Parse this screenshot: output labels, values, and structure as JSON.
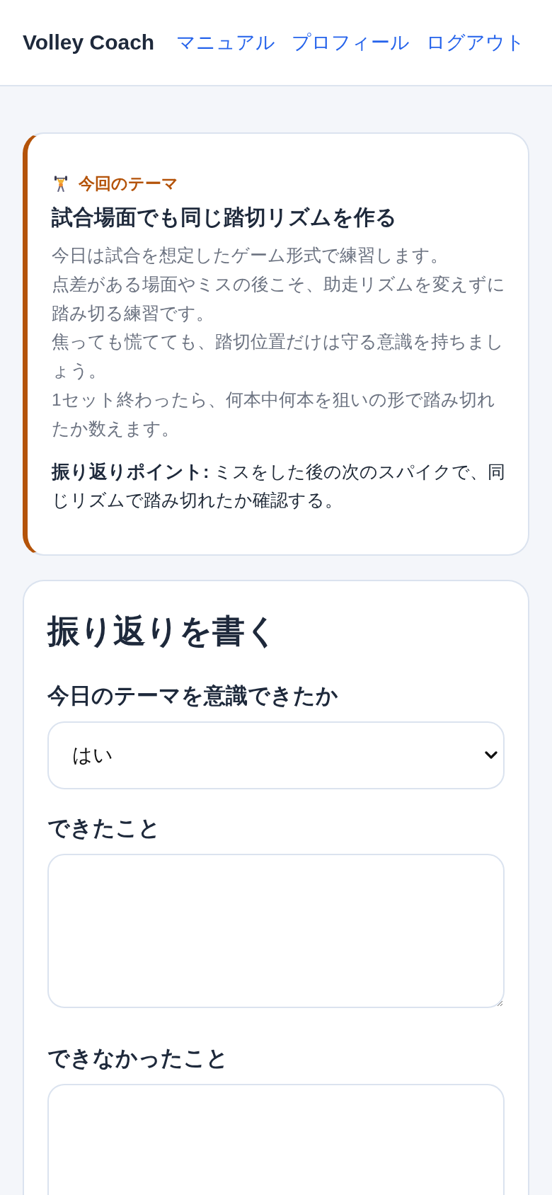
{
  "header": {
    "brand": "Volley Coach",
    "links": [
      "マニュアル",
      "プロフィール",
      "ログアウト"
    ]
  },
  "theme_card": {
    "label": "今回のテーマ",
    "title": "試合場面でも同じ踏切リズムを作る",
    "description": [
      "今日は試合を想定したゲーム形式で練習します。",
      "点差がある場面やミスの後こそ、助走リズムを変えずに踏み切る練習です。",
      "焦っても慌てても、踏切位置だけは守る意識を持ちましょう。",
      "1セット終わったら、何本中何本を狙いの形で踏み切れたか数えます。"
    ],
    "tip": "**振り返りポイント:** ミスをした後の次のスパイクで、同じリズムで踏み切れたか確認する。"
  },
  "reflection_form": {
    "heading": "振り返りを書く",
    "fields": [
      {
        "kind": "select",
        "label": "今日のテーマを意識できたか",
        "value": "はい"
      },
      {
        "kind": "textarea",
        "label": "できたこと"
      },
      {
        "kind": "textarea",
        "label": "できなかったこと"
      }
    ]
  }
}
